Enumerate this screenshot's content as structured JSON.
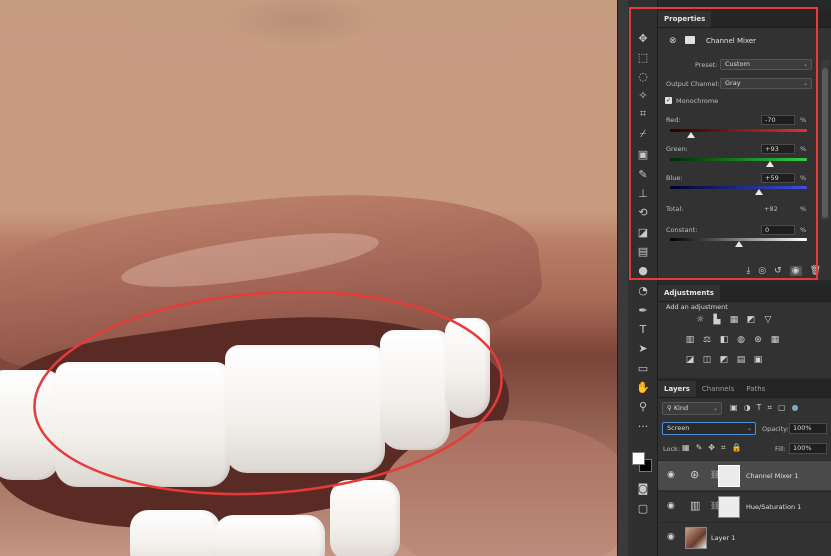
{
  "properties": {
    "tab": "Properties",
    "title": "Channel Mixer",
    "preset_label": "Preset:",
    "preset_value": "Custom",
    "output_label": "Output Channel:",
    "output_value": "Gray",
    "monochrome_label": "Monochrome",
    "monochrome_checked": true,
    "red_label": "Red:",
    "red_value": "-70",
    "red_fraction": 0.15,
    "green_label": "Green:",
    "green_value": "+93",
    "green_fraction": 0.73,
    "blue_label": "Blue:",
    "blue_value": "+59",
    "blue_fraction": 0.65,
    "total_label": "Total:",
    "total_value": "+82",
    "constant_label": "Constant:",
    "constant_value": "0",
    "constant_fraction": 0.5,
    "pct": "%"
  },
  "adjustments": {
    "tab": "Adjustments",
    "add_label": "Add an adjustment"
  },
  "layers": {
    "tabs": [
      "Layers",
      "Channels",
      "Paths"
    ],
    "kind_label": "Kind",
    "blend_mode": "Screen",
    "opacity_label": "Opacity:",
    "opacity_value": "100%",
    "lock_label": "Lock:",
    "fill_label": "Fill:",
    "fill_value": "100%",
    "items": [
      {
        "name": "Channel Mixer 1"
      },
      {
        "name": "Hue/Saturation 1"
      },
      {
        "name": "Layer 1"
      }
    ]
  },
  "colors": {
    "annotation_red": "#e63b3b",
    "panel_bg": "#323232"
  }
}
